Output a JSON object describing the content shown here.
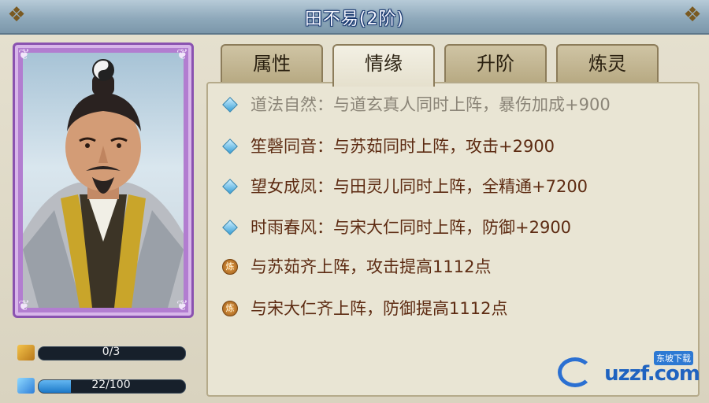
{
  "window": {
    "title": "田不易(2阶)"
  },
  "tabs": [
    {
      "label": "属性",
      "active": false
    },
    {
      "label": "情缘",
      "active": true
    },
    {
      "label": "升阶",
      "active": false
    },
    {
      "label": "炼灵",
      "active": false
    }
  ],
  "stats": [
    {
      "icon": "puzzle-piece-icon",
      "text": "0/3",
      "progress": 0.0
    },
    {
      "icon": "spirit-flame-icon",
      "text": "22/100",
      "progress": 0.22
    }
  ],
  "bonds": [
    {
      "icon": "diamond-icon",
      "text": "道法自然：与道玄真人同时上阵，暴伤加成+900",
      "active": false
    },
    {
      "icon": "diamond-icon",
      "text": "笙磬同音：与苏茹同时上阵，攻击+2900",
      "active": true
    },
    {
      "icon": "diamond-icon",
      "text": "望女成凤：与田灵儿同时上阵，全精通+7200",
      "active": true
    },
    {
      "icon": "diamond-icon",
      "text": "时雨春风：与宋大仁同时上阵，防御+2900",
      "active": true
    },
    {
      "icon": "refine-seal-icon",
      "text": "与苏茹齐上阵，攻击提高1112点",
      "active": true
    },
    {
      "icon": "refine-seal-icon",
      "text": "与宋大仁齐上阵，防御提高1112点",
      "active": true
    }
  ],
  "seal_glyph": "炼",
  "watermark": {
    "brand": "uzzf.com",
    "tag": "东坡下载"
  },
  "colors": {
    "card_border": "#8a52b0",
    "bond_text": "#5d2b12",
    "bond_text_dim": "#8b8578",
    "bar_fill": "#1c78c8"
  }
}
